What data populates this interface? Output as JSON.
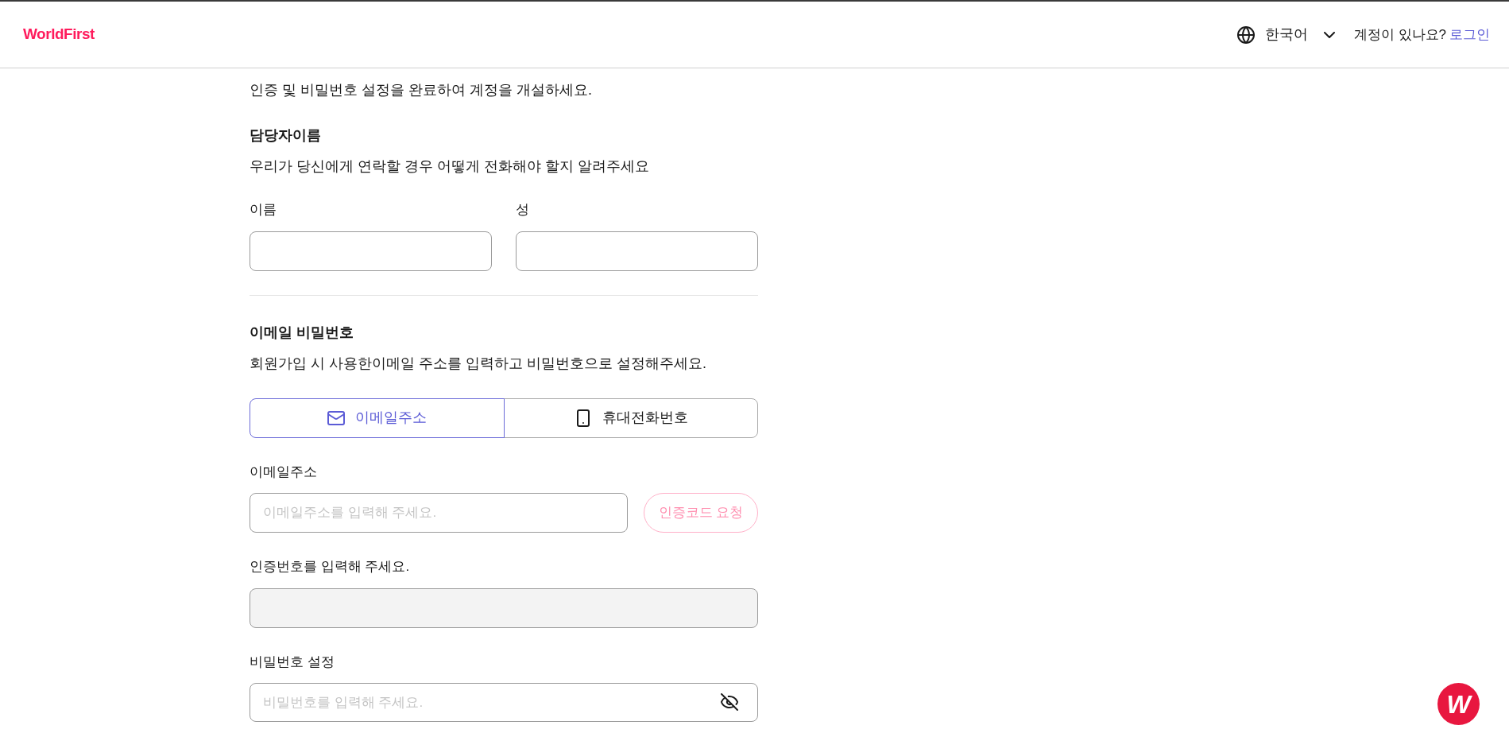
{
  "header": {
    "logo": "WorldFirst",
    "language": "한국어",
    "account_prompt": "계정이 있나요?",
    "login_link": "로그인"
  },
  "intro": "인증 및 비밀번호 설정을 완료하여 계정을 개설하세요.",
  "name_section": {
    "heading": "담당자이름",
    "description": "우리가 당신에게 연락할 경우 어떻게 전화해야 할지 알려주세요",
    "fields": [
      {
        "label": "이름"
      },
      {
        "label": "성"
      }
    ]
  },
  "credentials_section": {
    "heading": "이메일 비밀번호",
    "description": "회원가입 시 사용한이메일 주소를 입력하고 비밀번호으로 설정해주세요.",
    "tabs": [
      {
        "label": "이메일주소",
        "kind": "email",
        "selected": true
      },
      {
        "label": "휴대전화번호",
        "kind": "phone",
        "selected": false
      }
    ],
    "email_field": {
      "label": "이메일주소",
      "placeholder": "이메일주소를 입력해 주세요."
    },
    "request_button": {
      "label": "인증코드 요청",
      "disabled": true
    },
    "code_field": {
      "label": "인증번호를 입력해 주세요.",
      "disabled": true
    },
    "password_field": {
      "label": "비밀번호 설정",
      "placeholder": "비밀번호를 입력해 주세요."
    }
  },
  "chat_button": {
    "label": "W"
  }
}
